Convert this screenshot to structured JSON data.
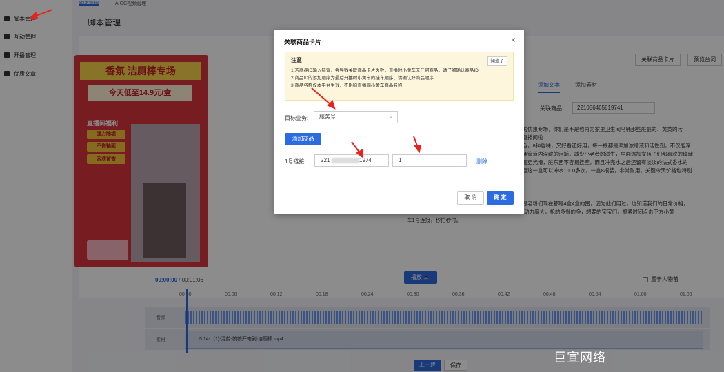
{
  "sidebar": {
    "items": [
      {
        "label": "脚本管理"
      },
      {
        "label": "互动管理"
      },
      {
        "label": "开播管理"
      },
      {
        "label": "优质文章"
      }
    ]
  },
  "header": {
    "tabs": [
      "脚本管理",
      "AIGC视频管理"
    ],
    "page_title": "脚本管理"
  },
  "preview": {
    "banner": "香氛 洁厕棒专场",
    "price": "今天低至14.9元/盒",
    "live_benefits": "直播间福利",
    "features": [
      "强力除垢",
      "不伤釉面",
      "去渍留香"
    ]
  },
  "right_panel": {
    "link_card_button": "关联商品卡片",
    "preview_button": "预览台词",
    "tabs": [
      "添加文本",
      "添加素材"
    ],
    "linked_product_label": "关联商品",
    "linked_product_value": "221056465819741",
    "script_lines": [
      "播的优惠专场，你们是不是也再为家里卫生间马桶那些脏脏的、黄黄的污",
      "对直播间啦",
      "颜色，8种香味，又好看还好用，每一根都是添加浓缩液和活性剂，不仅能深",
      "马桶管道内深藏的污垢，减少小老者的滋生，里面添加女孩子们都喜欢的玫瑰",
      "表面更光滑，脏东西不容易挂壁，而且冲完水之后还留有淡淡的法式香水的",
      "而且这一盒可以冲水1000多次，一盒8根装，非常耐用，关键今天价格也特别",
      "问是老粉们现在都是4盒4盒的囤，因为他们用过，也知道我们的日常价格，",
      "今天4盒只要59米都划算，我建议你们趁上今天的活动力度大，抢的多省的多，想要的宝宝们，抓紧时间点击下方小黄",
      "车1号连接，秒拍秒付。"
    ]
  },
  "timeline": {
    "current_time": "00:00:00",
    "total_time": "00:01:06",
    "play_label": "播放",
    "pin_label": "置于人物前",
    "ticks": [
      "00:00",
      "00:06",
      "00:12",
      "00:18",
      "00:24",
      "00:30",
      "00:36",
      "00:42",
      "00:48",
      "00:54",
      "01:00",
      "01:06"
    ],
    "audio_track_label": "音频",
    "material_track_label": "素材",
    "clip_name": "5.14-（1)-混剪-貌貌开箱剧-洁厕棒.mp4",
    "prev_button": "上一步",
    "save_button": "保存"
  },
  "modal": {
    "title": "关联商品卡片",
    "notice_title": "注意",
    "notice_lines": [
      "1.若商品ID输入错误，会导致关联商品卡片失败，直播时小黄车无任何商品，请仔细确认商品ID",
      "2.商品ID的添加顺序为最后开播时小黄车的挂车顺序，请确认好商品顺序",
      "3.商品名称仅本平台生效，不影响直播间小黄车商品名称"
    ],
    "notice_ack_button": "知道了",
    "business_label": "目标业务:",
    "business_value": "服务号",
    "add_product_button": "添加商品",
    "link_label": "1号链接:",
    "link_value_start": "221",
    "link_value_end": "1974",
    "quantity_value": "1",
    "delete_label": "删除",
    "cancel_button": "取 消",
    "ok_button": "确 定"
  },
  "watermark": "巨宣网络",
  "colors": {
    "accent": "#2c6be0",
    "arrow": "#e8231e",
    "notice_bg": "#fdf6dc"
  }
}
